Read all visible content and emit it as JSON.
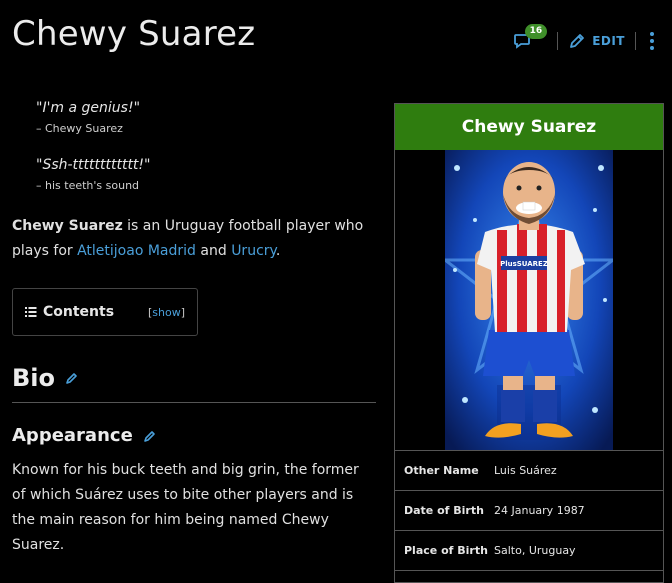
{
  "page": {
    "title": "Chewy Suarez",
    "comment_count": "16",
    "edit_label": "EDIT"
  },
  "quotes": [
    {
      "text": "\"I'm a genius!\"",
      "source": "– Chewy Suarez"
    },
    {
      "text": "\"Ssh-tttttttttttt!\"",
      "source": "– his teeth's sound"
    }
  ],
  "intro": {
    "name": "Chewy Suarez",
    "text_1": " is an Uruguay football player who plays for ",
    "link_1": "Atletijoao Madrid",
    "text_2": " and ",
    "link_2": "Urucry",
    "text_3": "."
  },
  "toc": {
    "title": "Contents",
    "bracket_open": "[",
    "toggle_label": "show",
    "bracket_close": "]"
  },
  "sections": {
    "bio_title": "Bio",
    "appearance_title": "Appearance",
    "appearance_text": "Known for his buck teeth and big grin, the former of which Suárez uses to bite other players and is the main reason for him being named Chewy Suarez."
  },
  "infobox": {
    "title": "Chewy Suarez",
    "shirt_sponsor": "PlusSUAREZ",
    "rows": [
      {
        "label": "Other Name",
        "value": "Luis Suárez"
      },
      {
        "label": "Date of Birth",
        "value": "24 January 1987"
      },
      {
        "label": "Place of Birth",
        "value": "Salto, Uruguay"
      }
    ]
  },
  "colors": {
    "accent_link": "#4a9fd9",
    "infobox_header": "#2f7d0f",
    "badge": "#3f8f2a"
  }
}
